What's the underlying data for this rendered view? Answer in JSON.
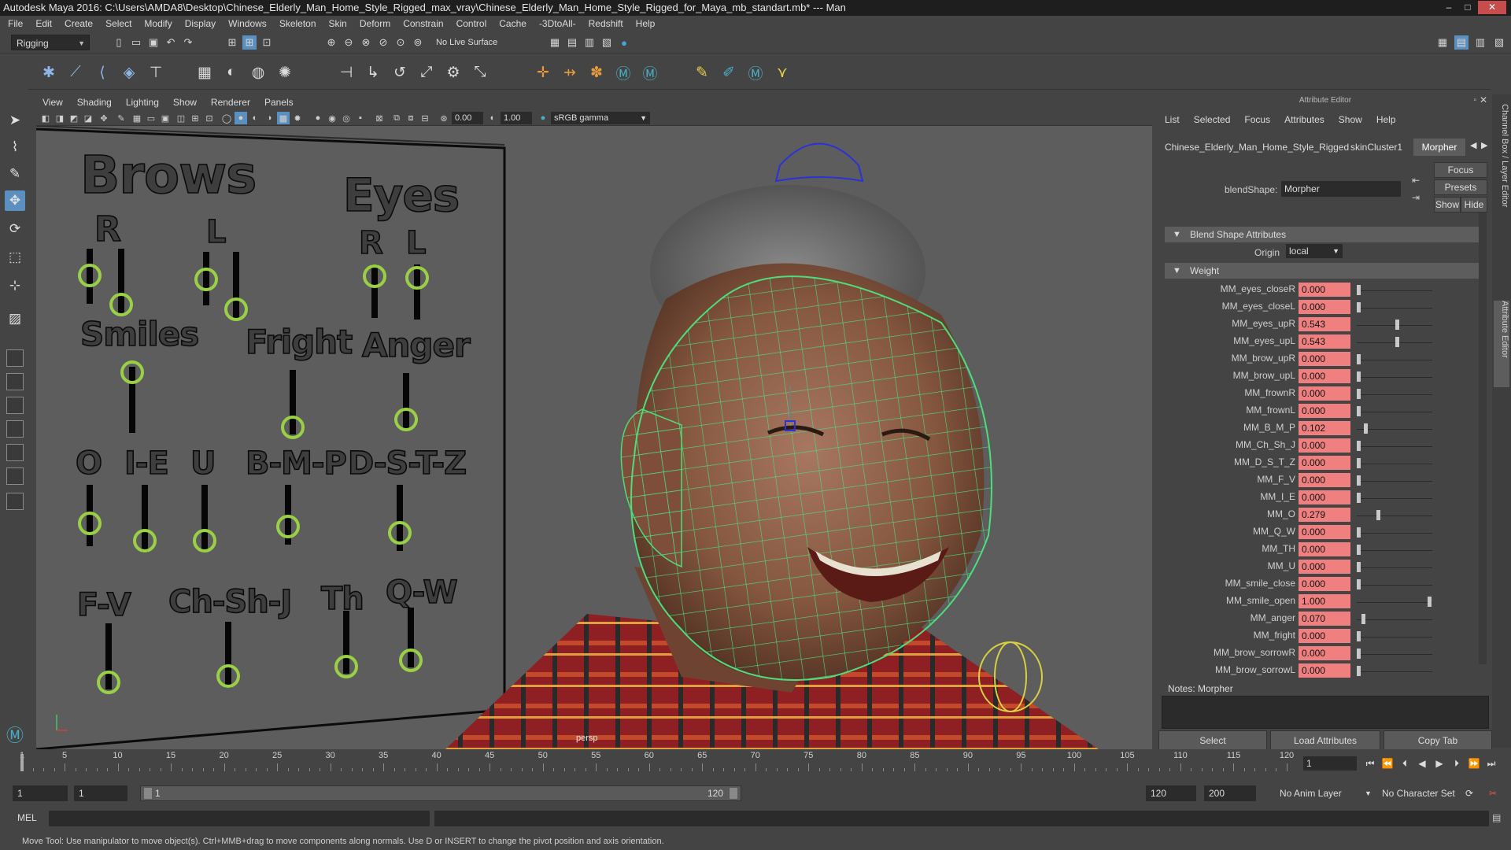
{
  "window": {
    "title": "Autodesk Maya 2016: C:\\Users\\AMDA8\\Desktop\\Chinese_Elderly_Man_Home_Style_Rigged_max_vray\\Chinese_Elderly_Man_Home_Style_Rigged_for_Maya_mb_standart.mb*  ---  Man",
    "controls": [
      "–",
      "□",
      "✕"
    ]
  },
  "menubar": [
    "File",
    "Edit",
    "Create",
    "Select",
    "Modify",
    "Display",
    "Windows",
    "Skeleton",
    "Skin",
    "Deform",
    "Constrain",
    "Control",
    "Cache",
    "-3DtoAll-",
    "Redshift",
    "Help"
  ],
  "statusline": {
    "mode": "Rigging",
    "live_surface": "No Live Surface"
  },
  "viewport": {
    "menu": [
      "View",
      "Shading",
      "Lighting",
      "Show",
      "Renderer",
      "Panels"
    ],
    "field_a": "0.00",
    "field_b": "1.00",
    "color_space": "sRGB gamma",
    "camera_label": "persp"
  },
  "face_panel": {
    "labels": {
      "brows": "Brows",
      "brows_r": "R",
      "brows_l": "L",
      "eyes": "Eyes",
      "eyes_r": "R",
      "eyes_l": "L",
      "smiles": "Smiles",
      "fright": "Fright",
      "anger": "Anger",
      "o": "O",
      "ie": "I-E",
      "u": "U",
      "bmp": "B-M-P",
      "dstz": "D-S-T-Z",
      "fv": "F-V",
      "chshj": "Ch-Sh-J",
      "th": "Th",
      "qw": "Q-W"
    }
  },
  "attribute_editor": {
    "title": "Attribute Editor",
    "menu": [
      "List",
      "Selected",
      "Focus",
      "Attributes",
      "Show",
      "Help"
    ],
    "tabs": [
      "Chinese_Elderly_Man_Home_Style_Rigged",
      "skinCluster1",
      "Morpher"
    ],
    "active_tab": "Morpher",
    "blendshape_label": "blendShape:",
    "blendshape_value": "Morpher",
    "buttons": {
      "focus": "Focus",
      "presets": "Presets",
      "show": "Show",
      "hide": "Hide"
    },
    "section_blend": "Blend Shape Attributes",
    "origin_label": "Origin",
    "origin_value": "local",
    "section_weight": "Weight",
    "weights": [
      {
        "name": "MM_eyes_closeR",
        "value": "0.000",
        "level": 0.0
      },
      {
        "name": "MM_eyes_closeL",
        "value": "0.000",
        "level": 0.0
      },
      {
        "name": "MM_eyes_upR",
        "value": "0.543",
        "level": 0.543
      },
      {
        "name": "MM_eyes_upL",
        "value": "0.543",
        "level": 0.543
      },
      {
        "name": "MM_brow_upR",
        "value": "0.000",
        "level": 0.0
      },
      {
        "name": "MM_brow_upL",
        "value": "0.000",
        "level": 0.0
      },
      {
        "name": "MM_frownR",
        "value": "0.000",
        "level": 0.0
      },
      {
        "name": "MM_frownL",
        "value": "0.000",
        "level": 0.0
      },
      {
        "name": "MM_B_M_P",
        "value": "0.102",
        "level": 0.102
      },
      {
        "name": "MM_Ch_Sh_J",
        "value": "0.000",
        "level": 0.0
      },
      {
        "name": "MM_D_S_T_Z",
        "value": "0.000",
        "level": 0.0
      },
      {
        "name": "MM_F_V",
        "value": "0.000",
        "level": 0.0
      },
      {
        "name": "MM_I_E",
        "value": "0.000",
        "level": 0.0
      },
      {
        "name": "MM_O",
        "value": "0.279",
        "level": 0.279
      },
      {
        "name": "MM_Q_W",
        "value": "0.000",
        "level": 0.0
      },
      {
        "name": "MM_TH",
        "value": "0.000",
        "level": 0.0
      },
      {
        "name": "MM_U",
        "value": "0.000",
        "level": 0.0
      },
      {
        "name": "MM_smile_close",
        "value": "0.000",
        "level": 0.0
      },
      {
        "name": "MM_smile_open",
        "value": "1.000",
        "level": 1.0
      },
      {
        "name": "MM_anger",
        "value": "0.070",
        "level": 0.07
      },
      {
        "name": "MM_fright",
        "value": "0.000",
        "level": 0.0
      },
      {
        "name": "MM_brow_sorrowR",
        "value": "0.000",
        "level": 0.0
      },
      {
        "name": "MM_brow_sorrowL",
        "value": "0.000",
        "level": 0.0
      }
    ],
    "notes_label": "Notes:  Morpher",
    "bottom_buttons": [
      "Select",
      "Load Attributes",
      "Copy Tab"
    ]
  },
  "side_tabs": [
    "Channel Box / Layer Editor",
    "Attribute Editor"
  ],
  "timeslider": {
    "ticks": [
      "1",
      "5",
      "10",
      "15",
      "20",
      "25",
      "30",
      "35",
      "40",
      "45",
      "50",
      "55",
      "60",
      "65",
      "70",
      "75",
      "80",
      "85",
      "90",
      "95",
      "100",
      "105",
      "110",
      "115",
      "120"
    ],
    "current_frame": "1"
  },
  "rangeslider": {
    "start": "1",
    "range_start": "1",
    "range_start_inner": "1",
    "range_end_inner": "120",
    "range_end": "120",
    "end": "200",
    "anim_layer": "No Anim Layer",
    "char_set": "No Character Set"
  },
  "cmdline": {
    "label": "MEL"
  },
  "helpline": "Move Tool: Use manipulator to move object(s). Ctrl+MMB+drag to move components along normals. Use D or INSERT to change the pivot position and axis orientation."
}
